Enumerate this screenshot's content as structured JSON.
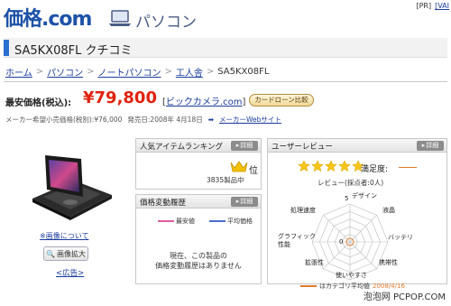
{
  "header": {
    "brand": "価格",
    "brand_suffix": ".com",
    "section_label": "パソコン",
    "links": [
      "[PR]",
      "[VAI"
    ]
  },
  "product": {
    "title": "SA5KX08FL クチコミ"
  },
  "breadcrumb": {
    "items": [
      "ホーム",
      "パソコン",
      "ノートパソコン",
      "工人舎",
      "SA5KX08FL"
    ],
    "separator": ">"
  },
  "price": {
    "label": "最安価格(税込):",
    "value": "¥79,800",
    "shop_open": "[",
    "shop": "ビックカメラ.com",
    "shop_close": "]",
    "loan_button": "カードローン比較"
  },
  "meta": {
    "msrp": "メーカー希望小売価格(税別):¥76,000",
    "release": "発売日:2008年 4月18日",
    "maker_site": "メーカーWebサイト"
  },
  "left_column": {
    "image_note": "※画像について",
    "zoom_button": "画像拡大",
    "ad_link": "<広告>"
  },
  "ranking_panel": {
    "title": "人気アイテムランキング",
    "detail_button": "詳細",
    "rank": "位",
    "count": "3835製品中"
  },
  "history_panel": {
    "title": "価格変動履歴",
    "detail_button": "詳細",
    "legend_min": "最安値",
    "legend_avg": "平均価格",
    "empty_line1": "現在、この製品の",
    "empty_line2": "価格変動履歴はありません",
    "colors": {
      "min": "#e05aa0",
      "avg": "#4a6fd0"
    }
  },
  "review_panel": {
    "title": "ユーザーレビュー",
    "detail_button": "詳細",
    "satisfaction_label": "満足度:",
    "review_count": "レビュー(採点者:0人)",
    "star_count": 5,
    "star_color": "#f5c518",
    "radar_labels": {
      "design": "デザイン",
      "lcd": "液晶",
      "battery": "バッテリ",
      "portability": "携帯性",
      "usability": "使いやすさ",
      "expandability": "拡張性",
      "graphics": "グラフィック性能",
      "speed": "処理速度"
    },
    "scale_max": "5",
    "scale_min": "0",
    "avg_note": "はカテゴリ平均値",
    "avg_date": "2008/4/16",
    "avg_color": "#e07a2a"
  },
  "watermark": "泡泡网 PCPOP.COM"
}
